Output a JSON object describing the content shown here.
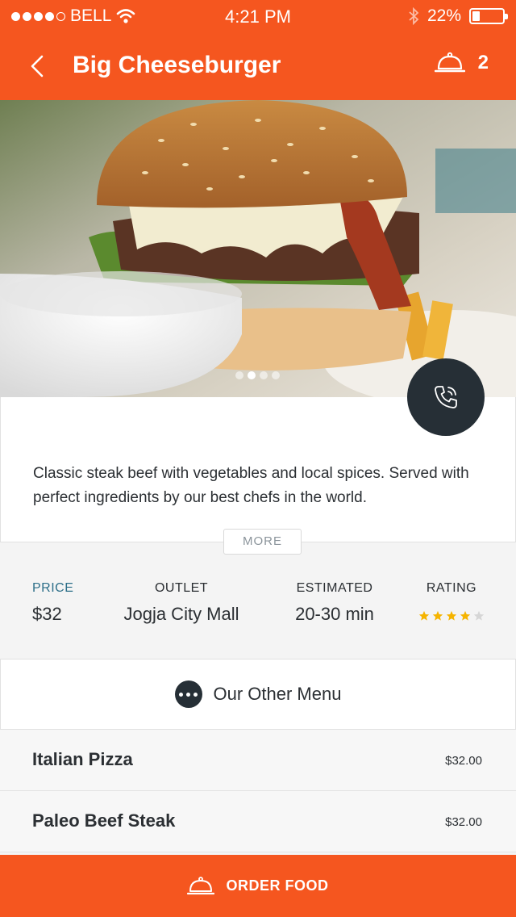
{
  "status_bar": {
    "carrier": "BELL",
    "time": "4:21 PM",
    "battery": "22%",
    "battery_level": 0.22,
    "signal_dots": 4
  },
  "header": {
    "title": "Big Cheeseburger",
    "cart_count": "2",
    "icons": [
      "back-chevron-icon",
      "food-cloche-icon"
    ]
  },
  "hero": {
    "pager_total": 4,
    "pager_active": 2
  },
  "description": {
    "text": "Classic steak beef with vegetables and local spices.  Served with perfect ingredients by our best chefs in the world.",
    "more_label": "MORE"
  },
  "info": {
    "price_label": "PRICE",
    "price_value": "$32",
    "outlet_label": "OUTLET",
    "outlet_value": "Jogja City Mall",
    "estimated_label": "ESTIMATED",
    "estimated_value": "20-30 min",
    "rating_label": "RATING",
    "rating_value": 4,
    "rating_max": 5
  },
  "other_menu": {
    "label": "Our Other Menu",
    "items": [
      {
        "name": "Italian Pizza",
        "price": "$32.00"
      },
      {
        "name": "Paleo Beef Steak",
        "price": "$32.00"
      }
    ]
  },
  "order_button": {
    "label": "ORDER FOOD"
  },
  "colors": {
    "accent": "#f5561f",
    "dark": "#262f36",
    "star": "#f5b400",
    "price_label": "#2d6f89"
  }
}
